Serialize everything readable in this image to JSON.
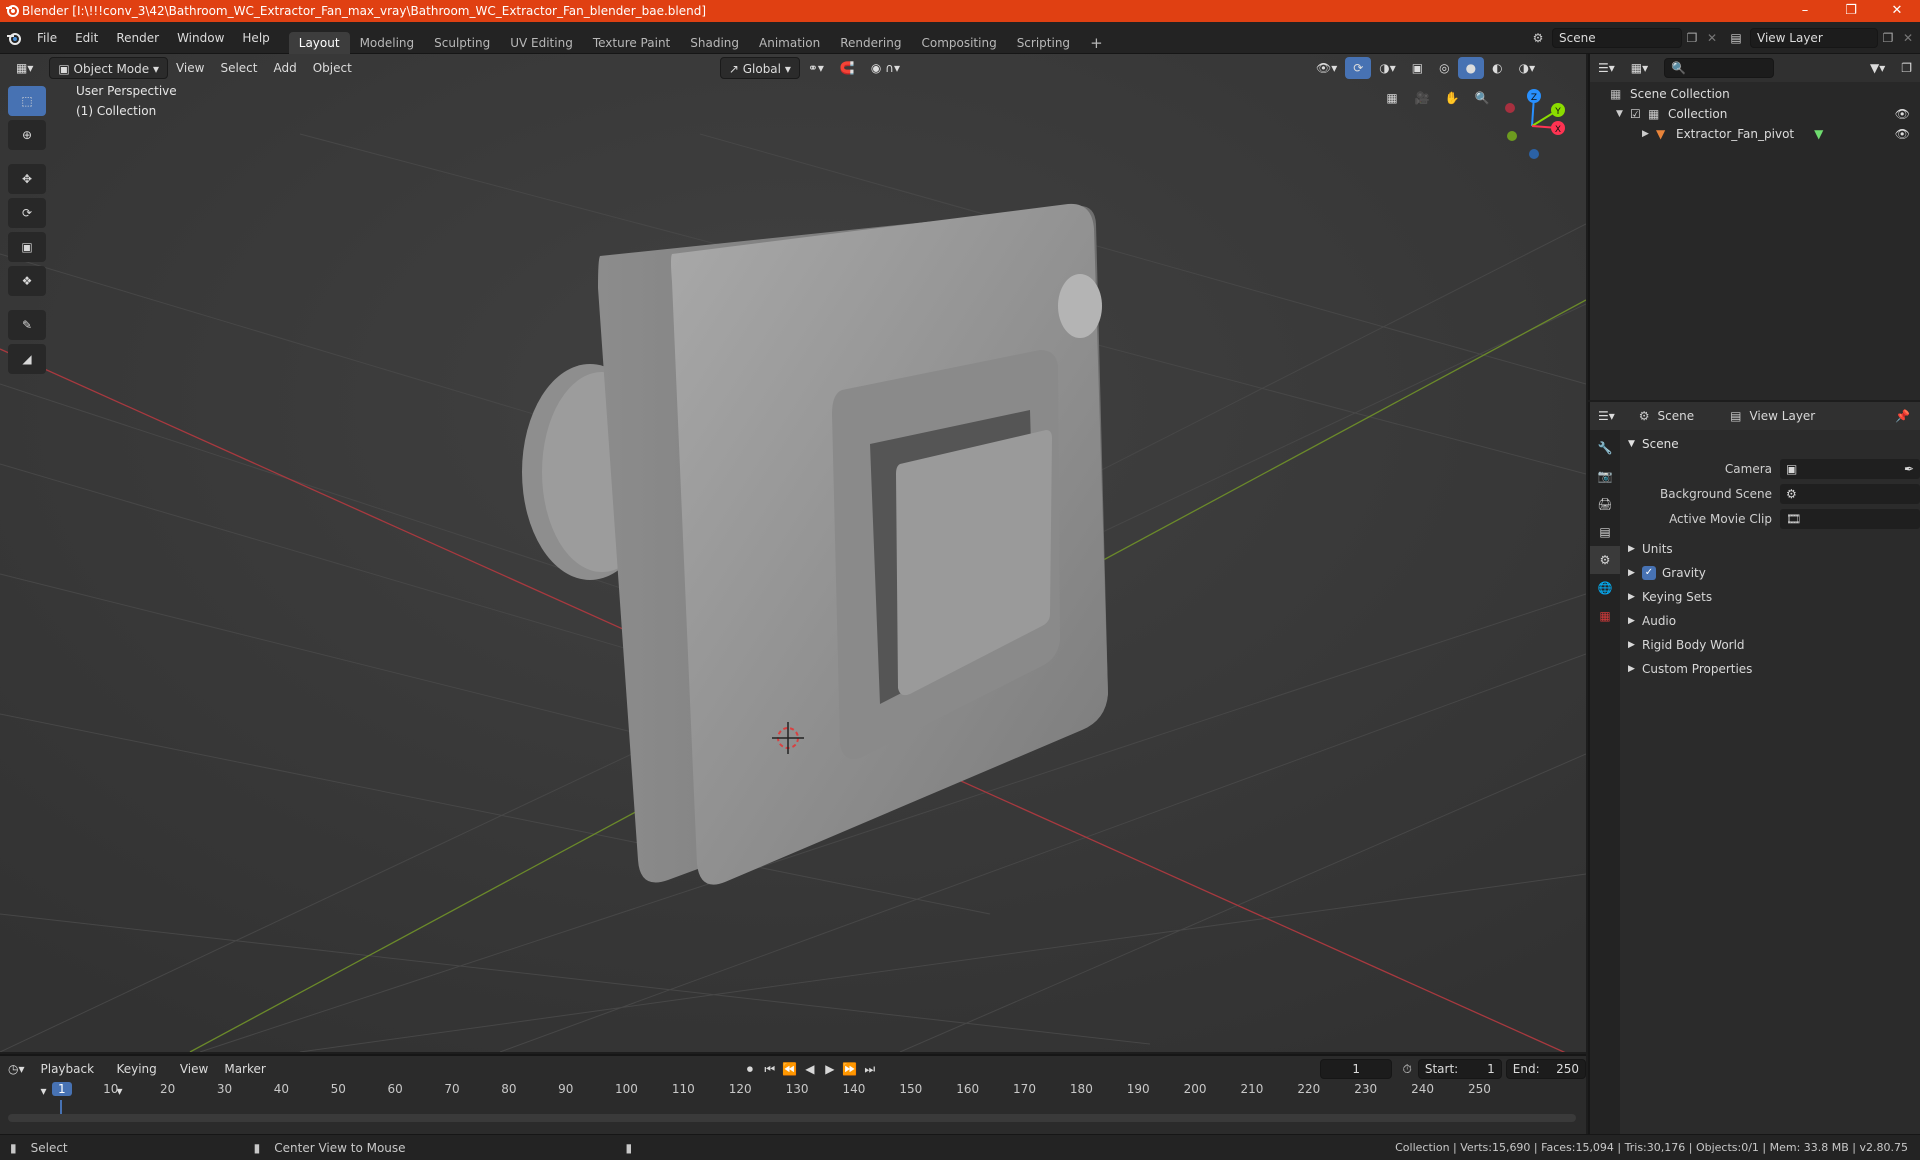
{
  "window": {
    "title": "Blender [I:\\!!!conv_3\\42\\Bathroom_WC_Extractor_Fan_max_vray\\Bathroom_WC_Extractor_Fan_blender_bae.blend]",
    "controls": [
      "minimize",
      "maximize",
      "close"
    ]
  },
  "menu": [
    "File",
    "Edit",
    "Render",
    "Window",
    "Help"
  ],
  "workspaces": [
    {
      "label": "Layout",
      "active": true
    },
    {
      "label": "Modeling",
      "active": false
    },
    {
      "label": "Sculpting",
      "active": false
    },
    {
      "label": "UV Editing",
      "active": false
    },
    {
      "label": "Texture Paint",
      "active": false
    },
    {
      "label": "Shading",
      "active": false
    },
    {
      "label": "Animation",
      "active": false
    },
    {
      "label": "Rendering",
      "active": false
    },
    {
      "label": "Compositing",
      "active": false
    },
    {
      "label": "Scripting",
      "active": false
    }
  ],
  "top_right": {
    "scene": "Scene",
    "view_layer": "View Layer"
  },
  "viewport": {
    "mode": "Object Mode",
    "menus": [
      "View",
      "Select",
      "Add",
      "Object"
    ],
    "orientation": "Global",
    "overlay_title": "User Perspective",
    "overlay_collection": "(1) Collection",
    "gizmo_axes": {
      "x": "X",
      "y": "Y",
      "z": "Z"
    },
    "tools": [
      "select-box",
      "cursor",
      "move",
      "rotate",
      "scale",
      "transform",
      "annotate",
      "measure"
    ]
  },
  "outliner": {
    "root": "Scene Collection",
    "collection": "Collection",
    "object": "Extractor_Fan_pivot"
  },
  "properties": {
    "tab_scene": "Scene",
    "tab_view_layer": "View Layer",
    "panel": "Scene",
    "fields": [
      {
        "label": "Camera",
        "value": ""
      },
      {
        "label": "Background Scene",
        "value": ""
      },
      {
        "label": "Active Movie Clip",
        "value": ""
      }
    ],
    "subpanels": [
      {
        "label": "Units",
        "checkbox": false
      },
      {
        "label": "Gravity",
        "checkbox": true
      },
      {
        "label": "Keying Sets",
        "checkbox": false
      },
      {
        "label": "Audio",
        "checkbox": false
      },
      {
        "label": "Rigid Body World",
        "checkbox": false
      },
      {
        "label": "Custom Properties",
        "checkbox": false
      }
    ]
  },
  "timeline": {
    "menus": [
      "Playback",
      "Keying",
      "View",
      "Marker"
    ],
    "current_frame": "1",
    "start_label": "Start:",
    "start": "1",
    "end_label": "End:",
    "end": "250",
    "ticks": [
      "1",
      "10",
      "20",
      "30",
      "40",
      "50",
      "60",
      "70",
      "80",
      "90",
      "100",
      "110",
      "120",
      "130",
      "140",
      "150",
      "160",
      "170",
      "180",
      "190",
      "200",
      "210",
      "220",
      "230",
      "240",
      "250"
    ]
  },
  "statusbar": {
    "left_action": "Select",
    "middle_action": "Center View to Mouse",
    "stats": "Collection | Verts:15,690 | Faces:15,094 | Tris:30,176 | Objects:0/1 | Mem: 33.8 MB | v2.80.75"
  },
  "colors": {
    "title_bar": "#e04012",
    "accent_blue": "#4772b3",
    "axis_x": "#ff3352",
    "axis_y": "#8bdc00",
    "axis_z": "#2890ff"
  }
}
